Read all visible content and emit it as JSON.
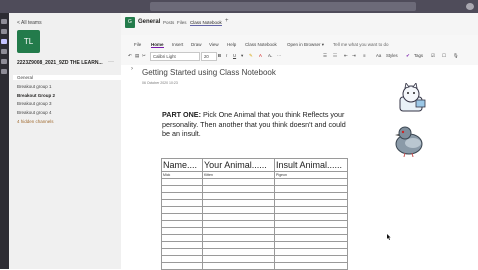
{
  "rail": {
    "icons": [
      "activity-icon",
      "chat-icon",
      "teams-icon",
      "calendar-icon",
      "calls-icon",
      "files-icon"
    ]
  },
  "left": {
    "back_label": "< All teams",
    "avatar_text": "TL",
    "team_name": "2223Z9008_2021_9ZD THE LEARN...",
    "more": "···",
    "channels": [
      {
        "label": "General",
        "style": "sel"
      },
      {
        "label": "Breakout group 1",
        "style": ""
      },
      {
        "label": "Breakout Group 2",
        "style": "bold"
      },
      {
        "label": "Breakout group 3",
        "style": ""
      },
      {
        "label": "Breakout group 4",
        "style": ""
      },
      {
        "label": "4 hidden channels",
        "style": "hidden"
      }
    ]
  },
  "header": {
    "avatar_text": "G",
    "title": "General",
    "tabs": [
      "Posts",
      "Files",
      "Class Notebook",
      "+"
    ]
  },
  "ribbon": {
    "tabs": [
      "File",
      "Home",
      "Insert",
      "Draw",
      "View",
      "Help",
      "Class Notebook",
      "Open in Browser ▾",
      "Tell me what you want to do"
    ],
    "font_name": "Calibri Light",
    "font_size": "20",
    "styles_label": "Styles",
    "tags_label": "Tags"
  },
  "page": {
    "title": "Getting Started using Class Notebook",
    "date": "06 October 2020    10:23",
    "part_label": "PART ONE:",
    "part_text": " Pick One Animal that you think Reflects your personality. Then another that you think doesn't and could be an insult."
  },
  "table": {
    "headers": [
      "Name....",
      "Your Animal......",
      "Insult Animal......"
    ],
    "rows": [
      [
        "Mick",
        "Kitten",
        "Pigeon"
      ],
      [
        "",
        "",
        ""
      ],
      [
        "",
        "",
        ""
      ],
      [
        "",
        "",
        ""
      ],
      [
        "",
        "",
        ""
      ],
      [
        "",
        "",
        ""
      ],
      [
        "",
        "",
        ""
      ],
      [
        "",
        "",
        ""
      ],
      [
        "",
        "",
        ""
      ],
      [
        "",
        "",
        ""
      ],
      [
        "",
        "",
        ""
      ],
      [
        "",
        "",
        ""
      ],
      [
        "",
        "",
        ""
      ],
      [
        "",
        "",
        ""
      ]
    ]
  },
  "colors": {
    "teams_purple": "#6264a7",
    "team_green": "#237b4b",
    "onenote_purple": "#7719aa"
  }
}
